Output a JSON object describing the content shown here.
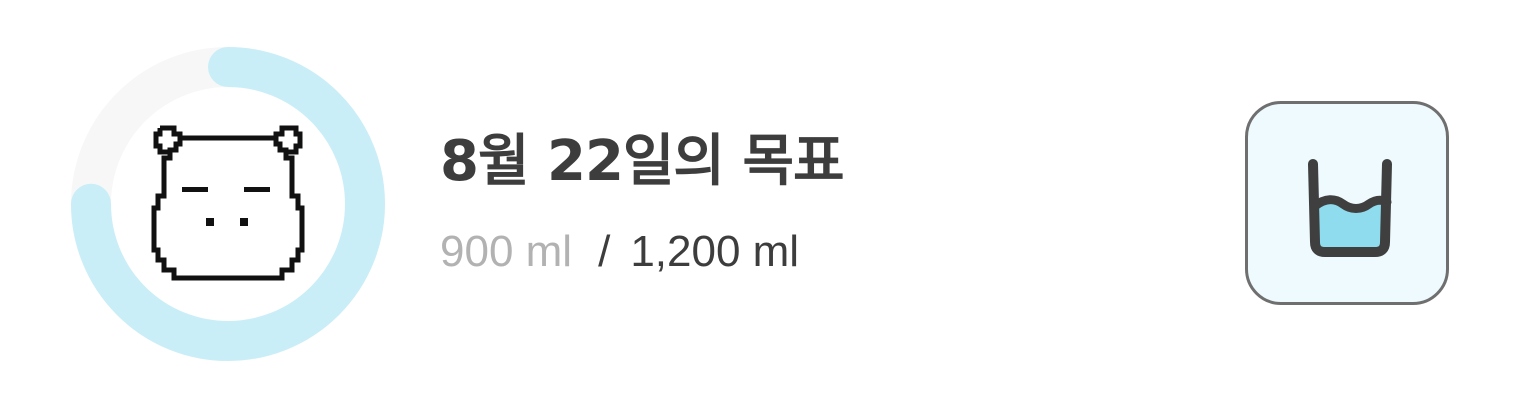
{
  "progress": {
    "current_ml": 900,
    "goal_ml": 1200,
    "fraction": 0.75,
    "track_color": "#f7f7f7",
    "fill_color": "#caeef7"
  },
  "header": {
    "title": "8월 22일의 목표"
  },
  "amounts": {
    "current_label": "900 ml",
    "separator": "/",
    "goal_label": "1,200 ml"
  },
  "mascot": {
    "icon": "pixel-hamster-icon"
  },
  "drink_button": {
    "icon": "water-glass-icon",
    "background": "#eefafd",
    "water_color": "#8fdcee"
  }
}
